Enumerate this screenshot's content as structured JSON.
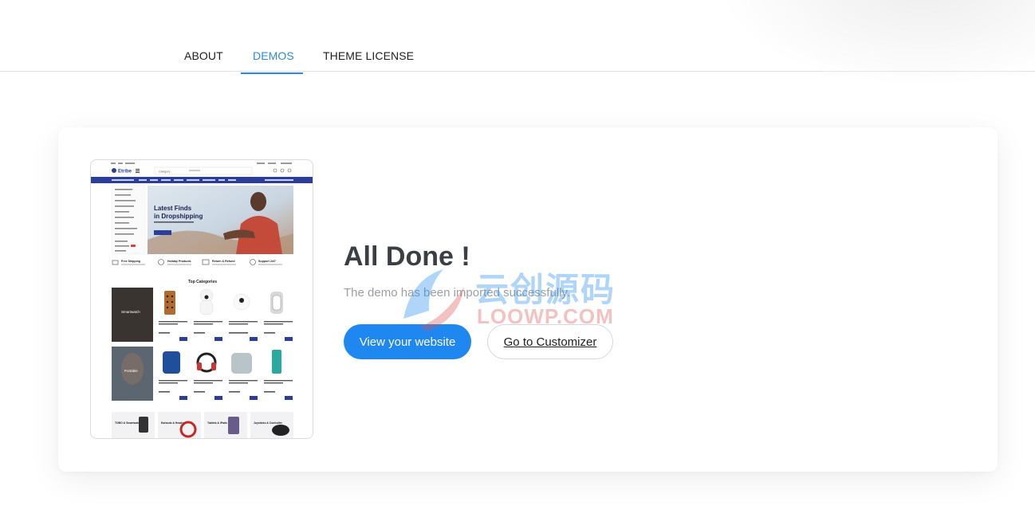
{
  "tabs": [
    {
      "label": "ABOUT",
      "active": false
    },
    {
      "label": "DEMOS",
      "active": true
    },
    {
      "label": "THEME LICENSE",
      "active": false
    }
  ],
  "colors": {
    "accent": "#2c8ae6",
    "button": "#1e88f0",
    "title": "#3a3f44",
    "subtitle": "#9aa0a6"
  },
  "preview": {
    "brand": "Etribe",
    "category_label": "Category",
    "hero_line1": "Latest Finds",
    "hero_line2": "in Dropshipping",
    "features": [
      "Free Shipping",
      "Holiday Products",
      "Return & Refund",
      "Support 24/7"
    ],
    "section_title": "Top Categories",
    "promo1": "Smartwatch",
    "promo2": "Portable",
    "bottom_cats": [
      "TOBO & Smartwatch",
      "Earbuds & Headset",
      "Tablets & iPads",
      "Joysticks & Controller"
    ]
  },
  "main": {
    "title": "All Done !",
    "subtitle": "The demo has been imported successfully.",
    "primary_button": "View your website",
    "secondary_button": "Go to Customizer"
  },
  "watermark": {
    "cn": "云创源码",
    "en": "LOOWP.COM"
  }
}
